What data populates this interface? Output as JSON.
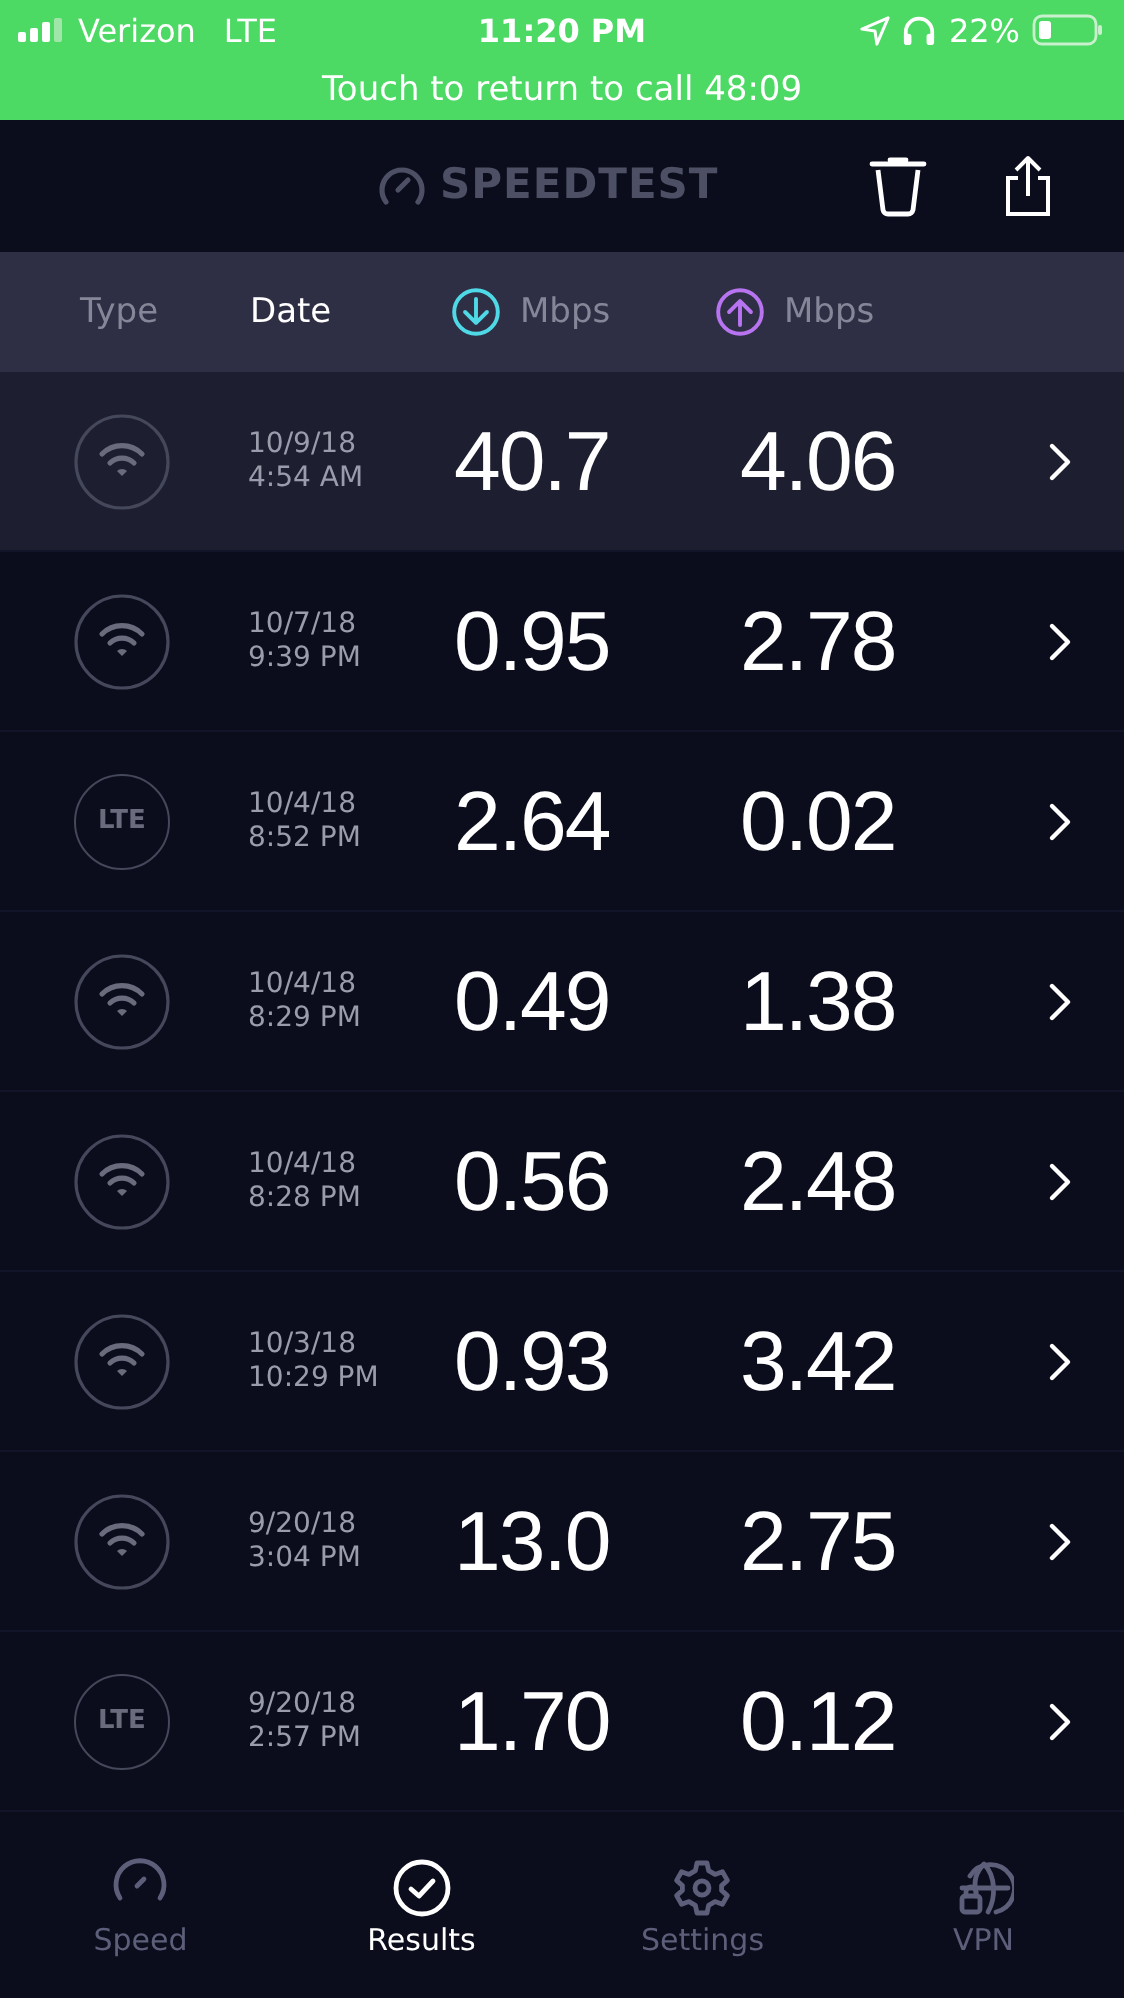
{
  "status_bar": {
    "carrier": "Verizon",
    "network": "LTE",
    "time": "11:20 PM",
    "battery": "22%"
  },
  "call_banner": "Touch to return to call 48:09",
  "header": {
    "logo": "SPEEDTEST"
  },
  "columns": [
    {
      "kind": "type",
      "label": "Type",
      "selected": false
    },
    {
      "kind": "date",
      "label": "Date",
      "selected": true
    },
    {
      "kind": "download",
      "label": "Mbps",
      "selected": false
    },
    {
      "kind": "upload",
      "label": "Mbps",
      "selected": false
    }
  ],
  "results": [
    {
      "kind": "wifi",
      "date": "10/9/18",
      "time": "4:54 AM",
      "download": "40.7",
      "upload": "4.06",
      "selected": true
    },
    {
      "kind": "wifi",
      "date": "10/7/18",
      "time": "9:39 PM",
      "download": "0.95",
      "upload": "2.78",
      "selected": false
    },
    {
      "kind": "lte",
      "type_label": "LTE",
      "date": "10/4/18",
      "time": "8:52 PM",
      "download": "2.64",
      "upload": "0.02",
      "selected": false
    },
    {
      "kind": "wifi",
      "date": "10/4/18",
      "time": "8:29 PM",
      "download": "0.49",
      "upload": "1.38",
      "selected": false
    },
    {
      "kind": "wifi",
      "date": "10/4/18",
      "time": "8:28 PM",
      "download": "0.56",
      "upload": "2.48",
      "selected": false
    },
    {
      "kind": "wifi",
      "date": "10/3/18",
      "time": "10:29 PM",
      "download": "0.93",
      "upload": "3.42",
      "selected": false
    },
    {
      "kind": "wifi",
      "date": "9/20/18",
      "time": "3:04 PM",
      "download": "13.0",
      "upload": "2.75",
      "selected": false
    },
    {
      "kind": "lte",
      "type_label": "LTE",
      "date": "9/20/18",
      "time": "2:57 PM",
      "download": "1.70",
      "upload": "0.12",
      "selected": false
    }
  ],
  "tabs": [
    {
      "kind": "speed",
      "label": "Speed",
      "selected": false
    },
    {
      "kind": "results",
      "label": "Results",
      "selected": true
    },
    {
      "kind": "settings",
      "label": "Settings",
      "selected": false
    },
    {
      "kind": "vpn",
      "label": "VPN",
      "selected": false
    }
  ]
}
